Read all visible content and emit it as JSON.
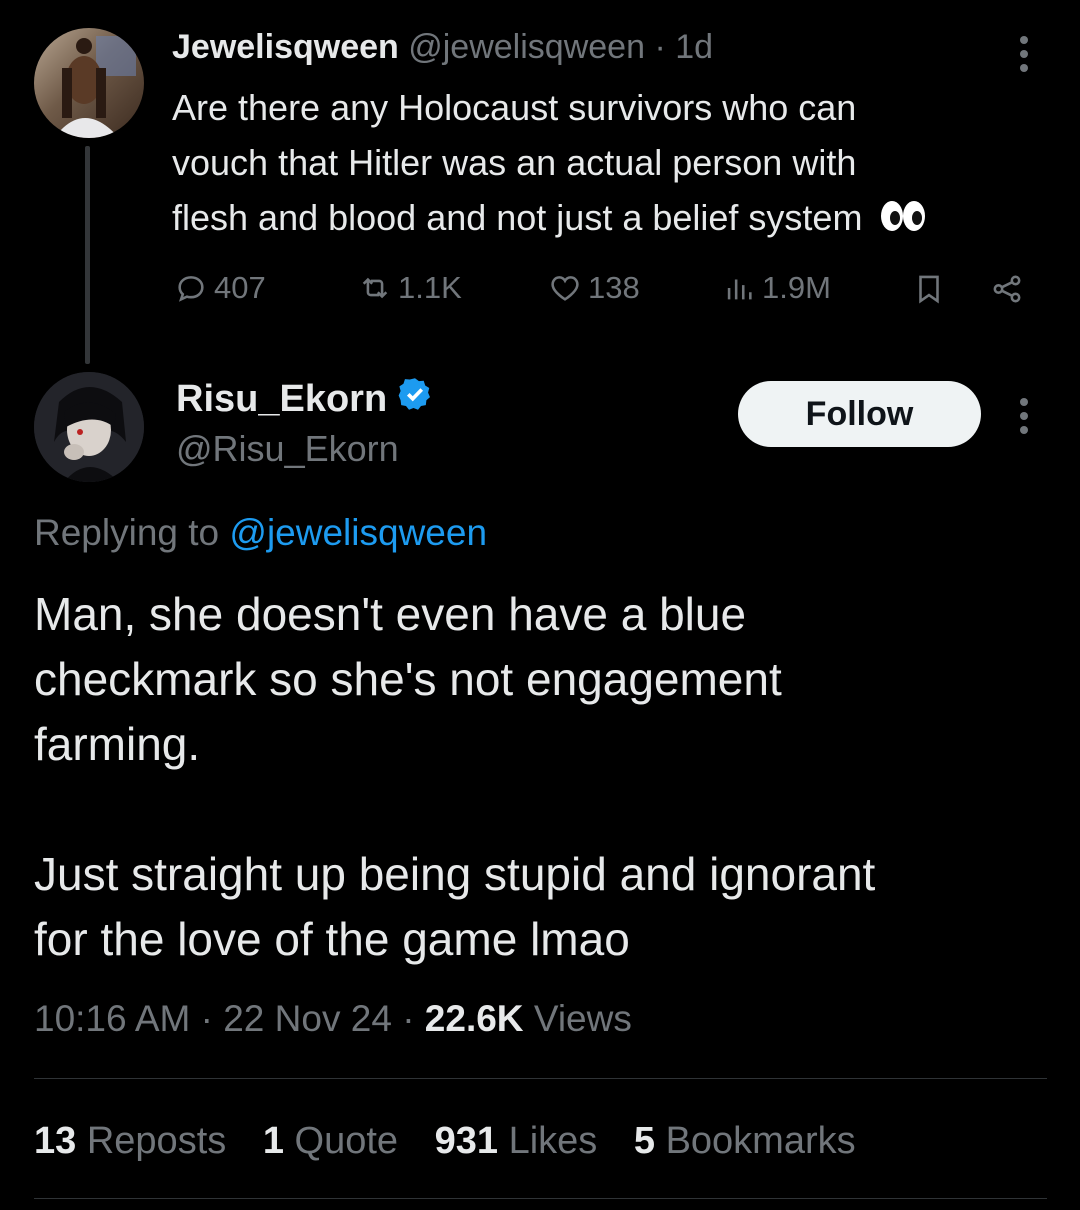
{
  "parent_tweet": {
    "display_name": "Jewelisqween",
    "handle": "@jewelisqween",
    "separator": "·",
    "time_ago": "1d",
    "text_lines": [
      "Are there any Holocaust survivors who can",
      "vouch that Hitler was an actual person with",
      "flesh and blood and not just a belief system"
    ],
    "emoji_icon": "eyes-emoji",
    "actions": {
      "replies": "407",
      "reposts": "1.1K",
      "likes": "138",
      "views": "1.9M"
    }
  },
  "main_tweet": {
    "display_name": "Risu_Ekorn",
    "handle": "@Risu_Ekorn",
    "verified_icon": "verified-badge-icon",
    "follow_label": "Follow",
    "replying_prefix": "Replying to",
    "replying_handle": "@jewelisqween",
    "text_lines": [
      "Man, she doesn't even have a blue",
      "checkmark so she's not engagement",
      "farming.",
      "",
      "Just straight up being stupid and ignorant",
      "for the love of the game lmao"
    ],
    "time": "10:16 AM",
    "date": "22 Nov 24",
    "views_count": "22.6K",
    "views_label": "Views",
    "stats": {
      "reposts_count": "13",
      "reposts_label": "Reposts",
      "quotes_count": "1",
      "quotes_label": "Quote",
      "likes_count": "931",
      "likes_label": "Likes",
      "bookmarks_count": "5",
      "bookmarks_label": "Bookmarks"
    }
  },
  "colors": {
    "background": "#000000",
    "text": "#e7e9ea",
    "muted": "#71767b",
    "link": "#1d9bf0",
    "divider": "#2f3336"
  }
}
